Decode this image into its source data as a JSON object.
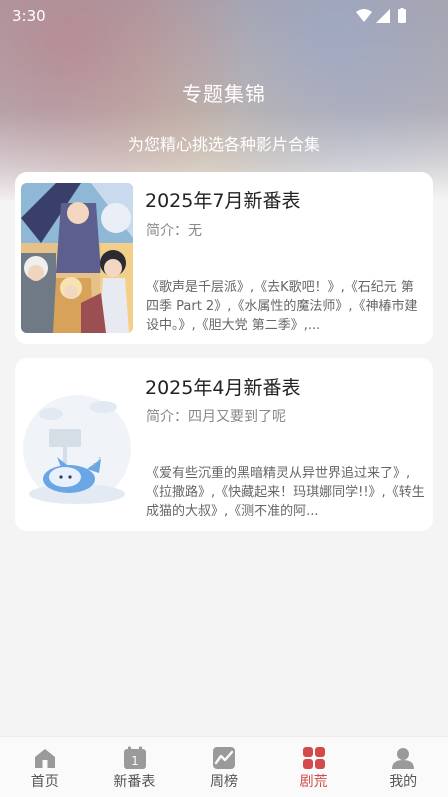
{
  "status_bar": {
    "time": "3:30"
  },
  "header": {
    "title": "专题集锦",
    "subtitle": "为您精心挑选各种影片合集"
  },
  "collections": [
    {
      "title": "2025年7月新番表",
      "intro": "简介：无",
      "description": "《歌声是千层派》,《去K歌吧！》,《石纪元 第四季 Part 2》,《水属性的魔法师》,《神椿市建设中。》,《胆大党 第二季》,..."
    },
    {
      "title": "2025年4月新番表",
      "intro": "简介：四月又要到了呢",
      "description": "《爱有些沉重的黑暗精灵从异世界追过来了》,《拉撒路》,《快藏起来！玛琪娜同学!!》,《转生成猫的大叔》,《测不准的阿..."
    }
  ],
  "tabbar": {
    "items": [
      {
        "label": "首页",
        "icon": "home-icon"
      },
      {
        "label": "新番表",
        "icon": "calendar-icon",
        "badge": "1"
      },
      {
        "label": "周榜",
        "icon": "chart-icon"
      },
      {
        "label": "剧荒",
        "icon": "grid-icon",
        "active": true
      },
      {
        "label": "我的",
        "icon": "user-icon"
      }
    ]
  },
  "colors": {
    "accent": "#d44a4a",
    "background": "#f4f4f4",
    "card": "#ffffff"
  }
}
